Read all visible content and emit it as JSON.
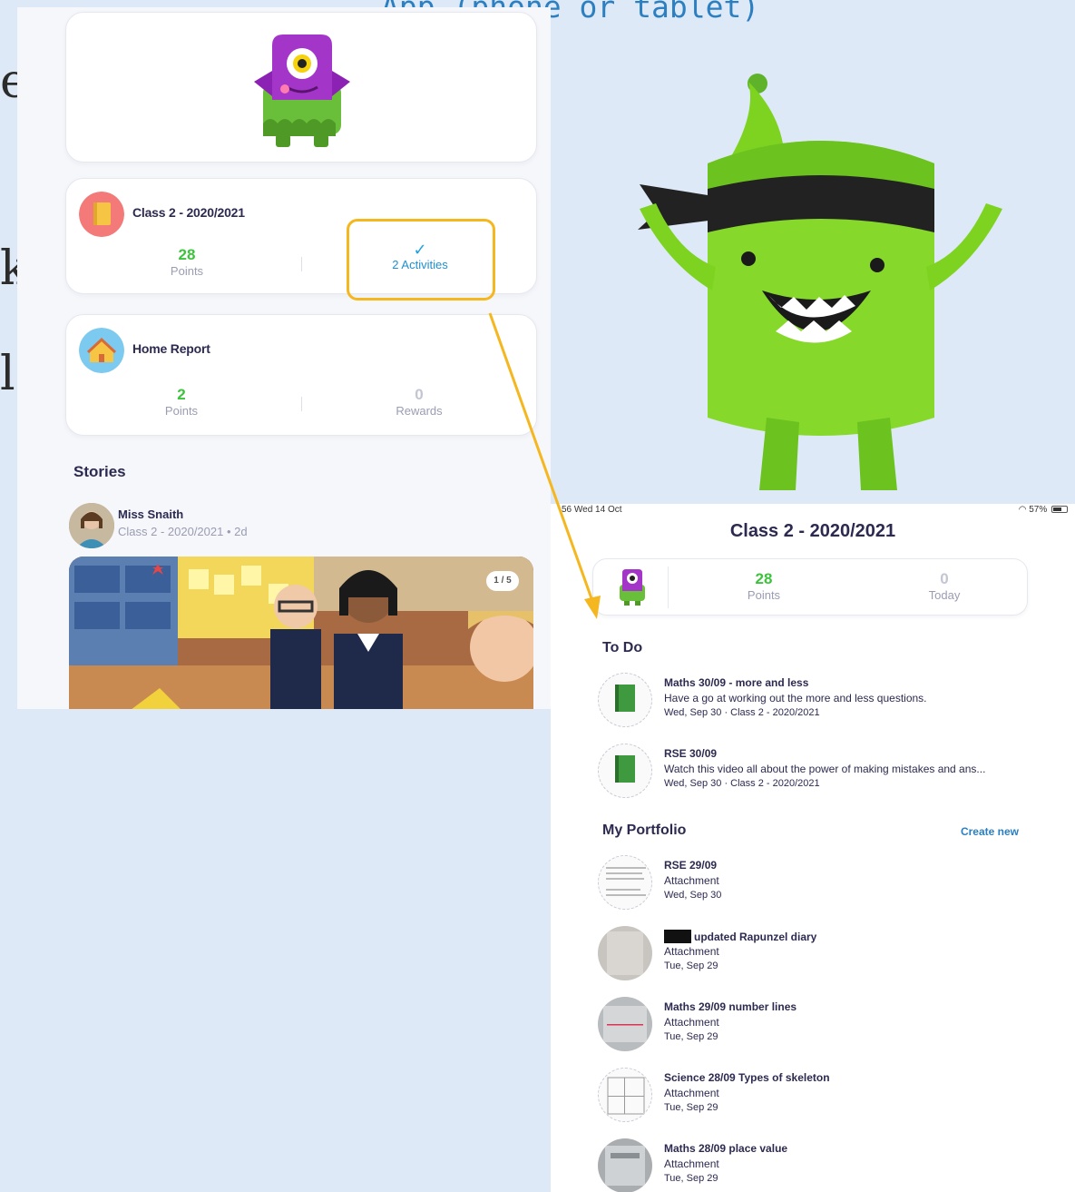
{
  "slide": {
    "title": "App (phone or tablet)",
    "edge_glyphs": [
      "er",
      "k",
      "l"
    ]
  },
  "student_app": {
    "class_card": {
      "name": "Class 2 - 2020/2021",
      "points": "28",
      "points_label": "Points",
      "activities_label": "2 Activities"
    },
    "home_report": {
      "name": "Home Report",
      "points": "2",
      "points_label": "Points",
      "rewards": "0",
      "rewards_label": "Rewards"
    },
    "stories": {
      "title": "Stories",
      "author": "Miss Snaith",
      "meta": "Class 2 - 2020/2021 • 2d",
      "photo_counter": "1 / 5"
    }
  },
  "dashboard": {
    "status_time": "56  Wed 14 Oct",
    "status_battery": "57%",
    "title": "Class 2 - 2020/2021",
    "points": "28",
    "points_label": "Points",
    "today": "0",
    "today_label": "Today",
    "todo_title": "To Do",
    "todo": [
      {
        "title": "Maths 30/09 - more and less",
        "desc": "Have a go at working out the more and less questions.",
        "meta": "Wed, Sep 30 · Class 2 - 2020/2021"
      },
      {
        "title": "RSE 30/09",
        "desc": "Watch this video all about the power of making mistakes and ans...",
        "meta": "Wed, Sep 30 · Class 2 - 2020/2021"
      }
    ],
    "portfolio_title": "My Portfolio",
    "create_new": "Create new",
    "portfolio": [
      {
        "title": "RSE 29/09",
        "type": "Attachment",
        "date": "Wed, Sep 30"
      },
      {
        "title": "updated Rapunzel diary",
        "type": "Attachment",
        "date": "Tue, Sep 29"
      },
      {
        "title": "Maths 29/09 number lines",
        "type": "Attachment",
        "date": "Tue, Sep 29"
      },
      {
        "title": "Science 28/09 Types of skeleton",
        "type": "Attachment",
        "date": "Tue, Sep 29"
      },
      {
        "title": "Maths 28/09 place value",
        "type": "Attachment",
        "date": "Tue, Sep 29"
      }
    ]
  },
  "colors": {
    "background": "#dde9f6",
    "navy_text": "#2c2a50",
    "green_points": "#3bc43b",
    "highlight": "#f5b71f",
    "link_blue": "#2b7fc1",
    "mascot_green": "#7ed321"
  }
}
